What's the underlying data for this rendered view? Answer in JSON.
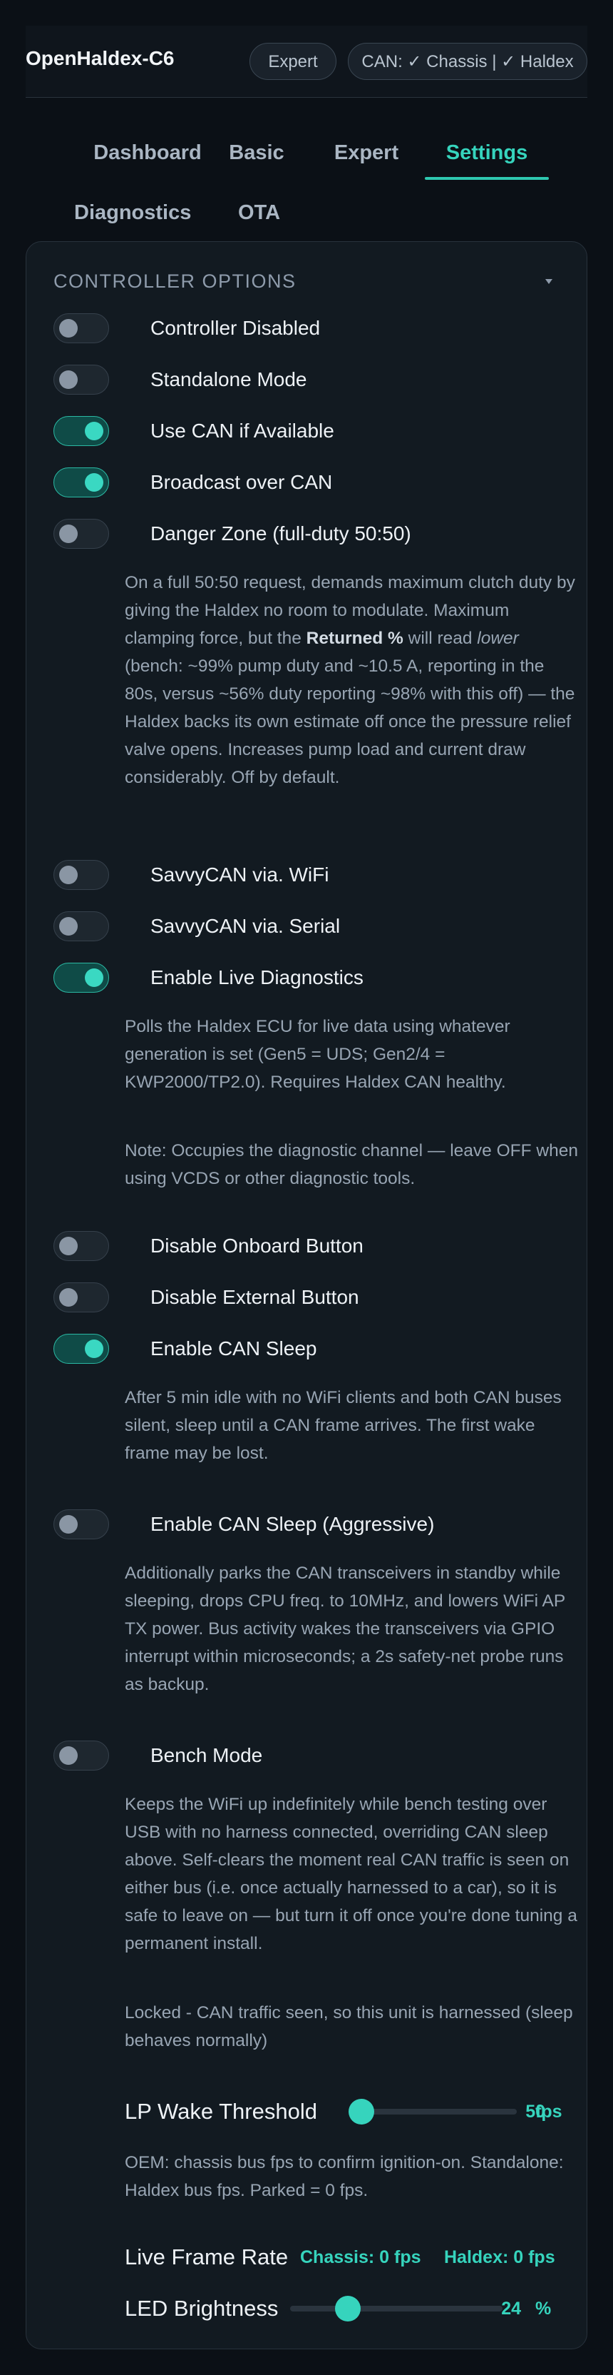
{
  "header": {
    "title": "OpenHaldex-C6",
    "mode_badge": "Expert",
    "can_status": "CAN: ✓ Chassis | ✓ Haldex"
  },
  "tabs": [
    {
      "label": "Dashboard",
      "active": false
    },
    {
      "label": "Basic",
      "active": false
    },
    {
      "label": "Expert",
      "active": false
    },
    {
      "label": "Settings",
      "active": true
    },
    {
      "label": "Diagnostics",
      "active": false
    },
    {
      "label": "OTA",
      "active": false
    }
  ],
  "panel": {
    "title": "CONTROLLER OPTIONS",
    "toggles": [
      {
        "label": "Controller Disabled",
        "on": false
      },
      {
        "label": "Standalone Mode",
        "on": false
      },
      {
        "label": "Use CAN if Available",
        "on": true
      },
      {
        "label": "Broadcast over CAN",
        "on": true
      },
      {
        "label": "Danger Zone (full-duty 50:50)",
        "on": false
      },
      {
        "label": "SavvyCAN via. WiFi",
        "on": false
      },
      {
        "label": "SavvyCAN via. Serial",
        "on": false
      },
      {
        "label": "Enable Live Diagnostics",
        "on": true
      },
      {
        "label": "Disable Onboard Button",
        "on": false
      },
      {
        "label": "Disable External Button",
        "on": false
      },
      {
        "label": "Enable CAN Sleep",
        "on": true
      },
      {
        "label": "Enable CAN Sleep (Aggressive)",
        "on": false
      },
      {
        "label": "Bench Mode",
        "on": false
      }
    ],
    "danger_desc": {
      "part1": "On a full 50:50 request, demands maximum clutch duty by giving the Haldex no room to modulate. Maximum clamping force, but the ",
      "bold": "Returned %",
      "part2": " will read ",
      "italic": "lower",
      "part3": " (bench: ~99% pump duty and ~10.5 A, reporting in the 80s, versus ~56% duty reporting ~98% with this off) — the Haldex backs its own estimate off once the pressure relief valve opens. Increases pump load and current draw considerably. Off by default."
    },
    "live_diag_desc": "Polls the Haldex ECU for live data using whatever generation is set (Gen5 = UDS; Gen2/4 = KWP2000/TP2.0). Requires Haldex CAN healthy.",
    "live_diag_note": "Note: Occupies the diagnostic channel — leave OFF when using VCDS or other diagnostic tools.",
    "can_sleep_desc": "After 5 min idle with no WiFi clients and both CAN buses silent, sleep until a CAN frame arrives. The first wake frame may be lost.",
    "aggressive_desc": "Additionally parks the CAN transceivers in standby while sleeping, drops CPU freq. to 10MHz, and lowers WiFi AP TX power. Bus activity wakes the transceivers via GPIO interrupt within microseconds; a 2s safety-net probe runs as backup.",
    "bench_desc": "Keeps the WiFi up indefinitely while bench testing over USB with no harness connected, overriding CAN sleep above. Self-clears the moment real CAN traffic is seen on either bus (i.e. once actually harnessed to a car), so it is safe to leave on — but turn it off once you're done tuning a permanent install.",
    "bench_status": "Locked - CAN traffic seen, so this unit is harnessed (sleep behaves normally)",
    "lp_wake": {
      "label": "LP Wake Threshold",
      "value": "50",
      "unit": "fps",
      "fraction": 0.0
    },
    "lp_wake_desc": "OEM: chassis bus fps to confirm ignition-on. Standalone: Haldex bus fps. Parked = 0 fps.",
    "live_frame_rate": {
      "label": "Live Frame Rate",
      "chassis": "Chassis: 0 fps",
      "haldex": "Haldex: 0 fps"
    },
    "led": {
      "label": "LED Brightness",
      "value": "24",
      "unit": "%",
      "fraction": 0.24
    }
  }
}
